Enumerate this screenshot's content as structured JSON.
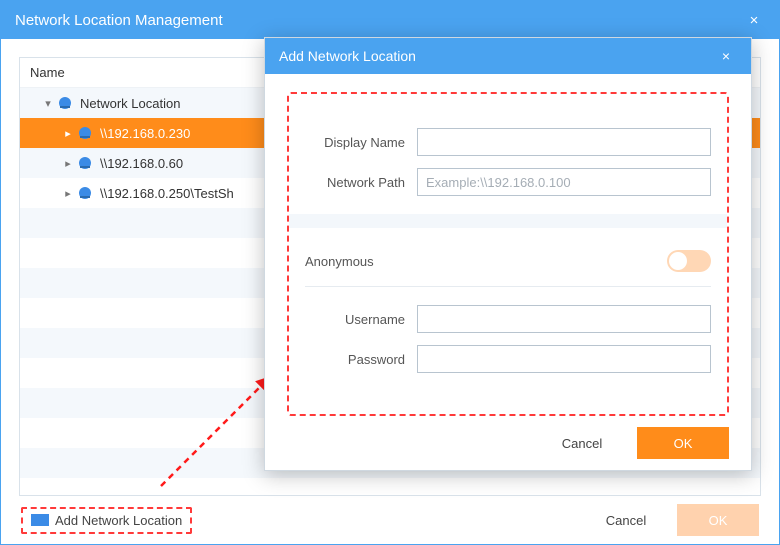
{
  "window": {
    "title": "Network Location Management",
    "close": "×"
  },
  "tree": {
    "header": "Name",
    "root": {
      "label": "Network Location",
      "expanded": true
    },
    "items": [
      {
        "label": "\\\\192.168.0.230",
        "selected": true
      },
      {
        "label": "\\\\192.168.0.60",
        "selected": false
      },
      {
        "label": "\\\\192.168.0.250\\TestSh",
        "selected": false
      }
    ]
  },
  "footer": {
    "add_label": "Add Network Location",
    "cancel": "Cancel",
    "ok": "OK"
  },
  "modal": {
    "title": "Add Network Location",
    "close": "×",
    "display_name_label": "Display Name",
    "display_name_value": "",
    "network_path_label": "Network Path",
    "network_path_placeholder": "Example:\\\\192.168.0.100",
    "network_path_value": "",
    "anonymous_label": "Anonymous",
    "anonymous_on": false,
    "username_label": "Username",
    "username_value": "",
    "password_label": "Password",
    "password_value": "",
    "cancel": "Cancel",
    "ok": "OK"
  },
  "colors": {
    "accent": "#ff8c1a",
    "primary": "#4aa3f0",
    "highlight": "#ff3a3a"
  }
}
